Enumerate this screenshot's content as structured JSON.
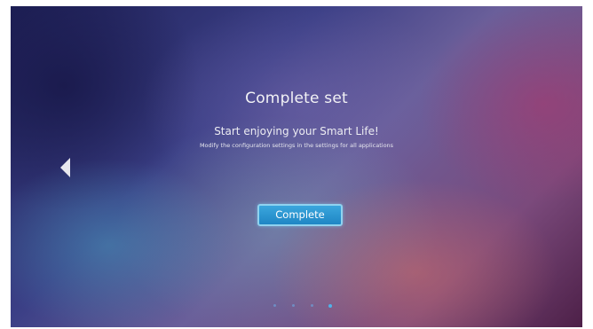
{
  "setup_page": {
    "title": "Complete set",
    "subtitle": "Start enjoying your Smart Life!",
    "description": "Modify the configuration settings in the settings for all applications",
    "complete_button_label": "Complete",
    "back_icon": "left-triangle-icon",
    "pagination": {
      "total_pages": 4,
      "current_page": 4
    }
  },
  "colors": {
    "button_fill": "#2796d2",
    "button_border": "#8fd2ef",
    "active_dot": "#4fb3ea",
    "text": "#f2f2f5"
  }
}
